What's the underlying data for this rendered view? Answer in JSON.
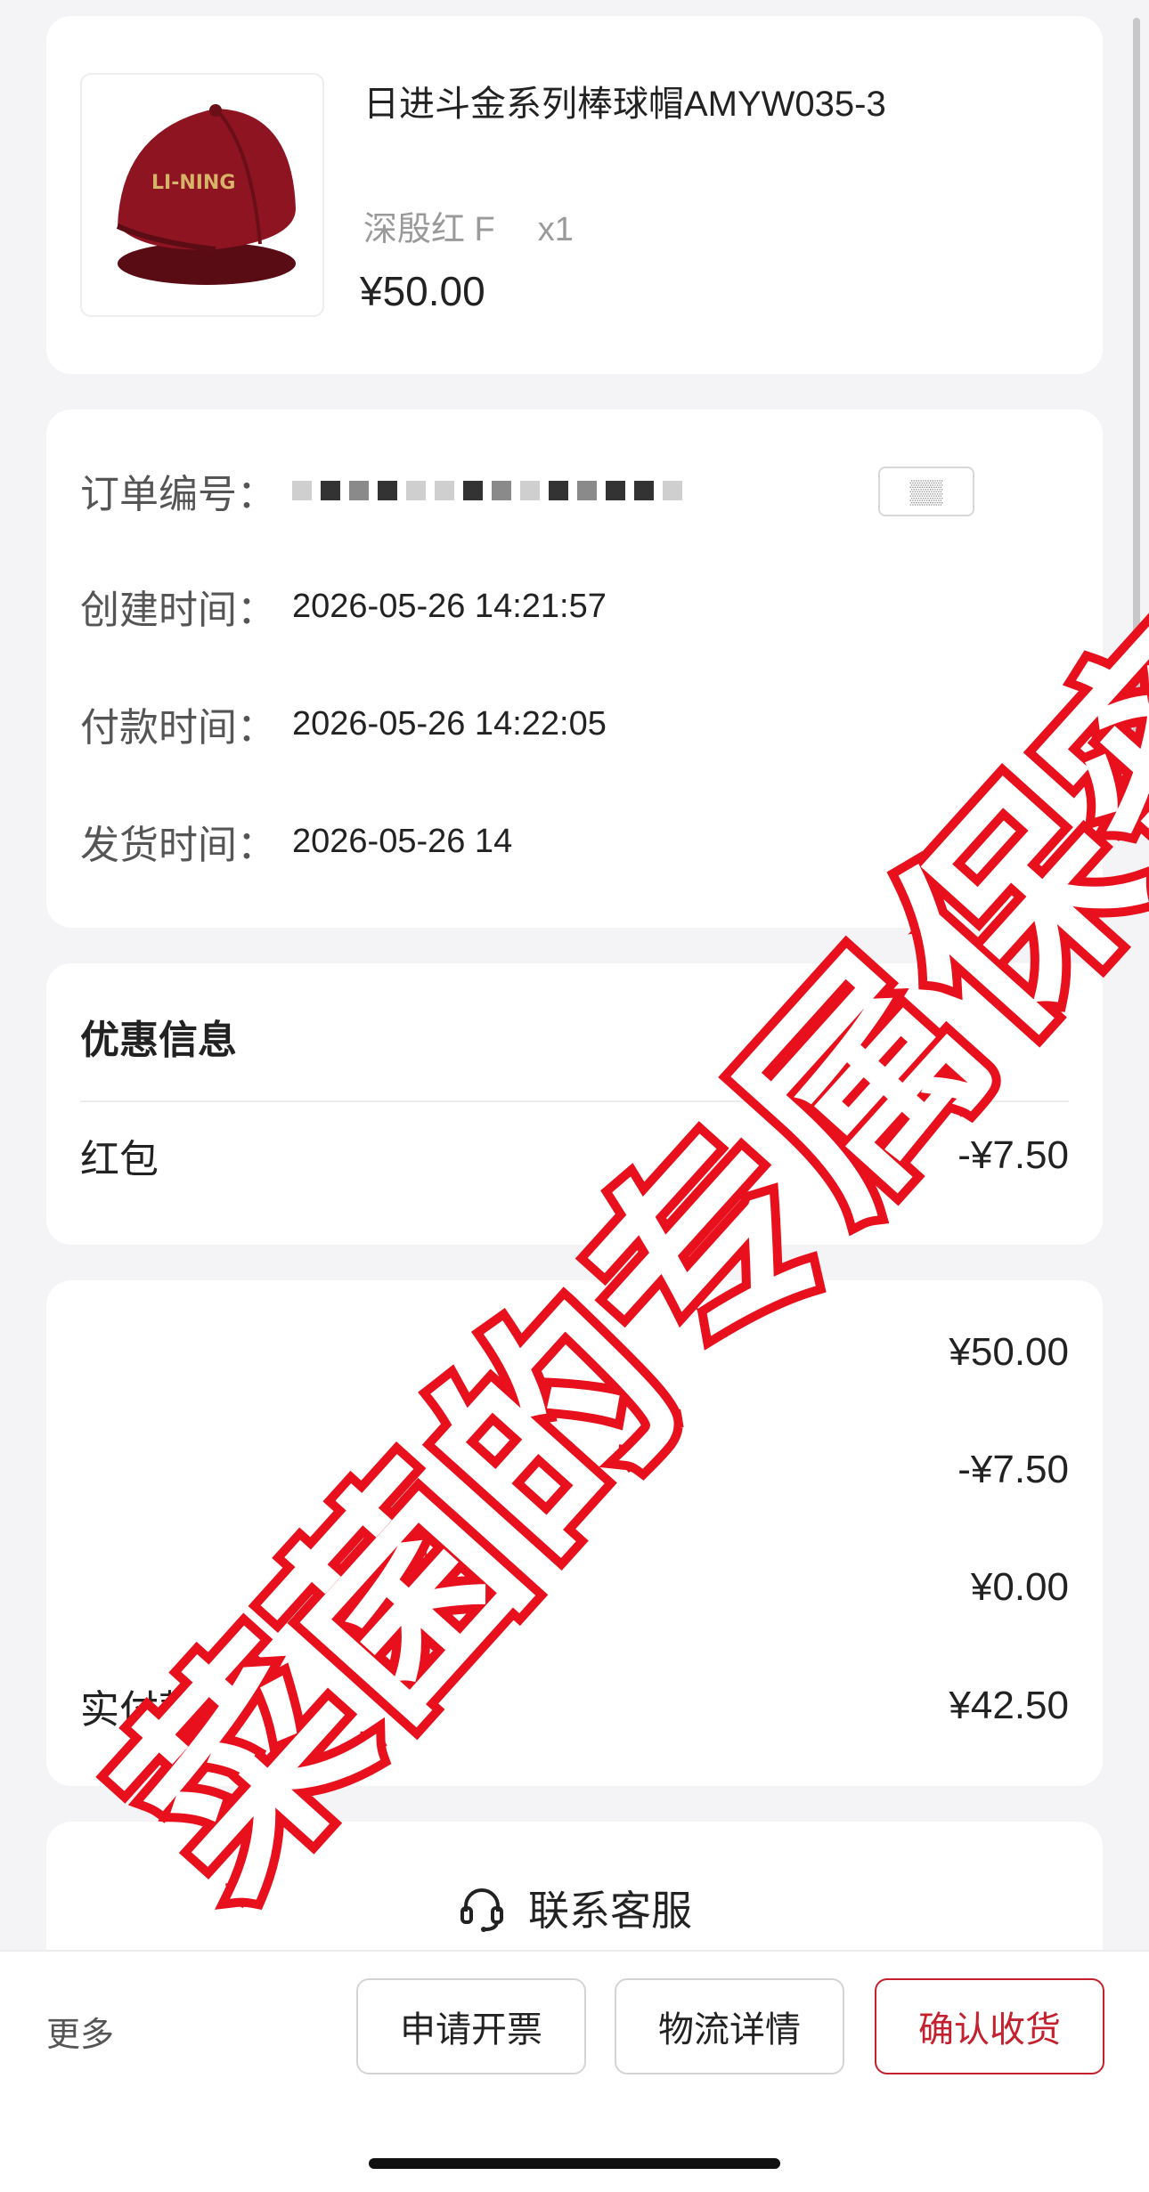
{
  "product": {
    "title": "日进斗金系列棒球帽AMYW035-3",
    "spec": "深殷红 F",
    "quantity": "x1",
    "price": "¥50.00",
    "image_brand": "LI-NING"
  },
  "order_info": {
    "order_number_label": "订单编号：",
    "create_time_label": "创建时间：",
    "create_time": "2026-05-26 14:21:57",
    "pay_time_label": "付款时间：",
    "pay_time": "2026-05-26 14:22:05",
    "ship_time_label": "发货时间：",
    "ship_time": "2026-05-26 14"
  },
  "coupon": {
    "title": "优惠信息",
    "red_packet_label": "红包",
    "red_packet_value": "-¥7.50"
  },
  "totals": {
    "goods_total_value": "¥50.00",
    "discount_value": "-¥7.50",
    "freight_value": "¥0.00",
    "paid_label": "实付款",
    "paid_value": "¥42.50"
  },
  "service": {
    "contact_label": "联系客服",
    "icon": "headset-icon"
  },
  "bottom_bar": {
    "more_label": "更多",
    "invoice_button": "申请开票",
    "logistics_button": "物流详情",
    "confirm_button": "确认收货"
  },
  "watermark": {
    "text": "菜菌的专属保密"
  },
  "colors": {
    "accent": "#c4202d",
    "watermark_stroke": "#e8101c",
    "background": "#f4f4f6"
  }
}
